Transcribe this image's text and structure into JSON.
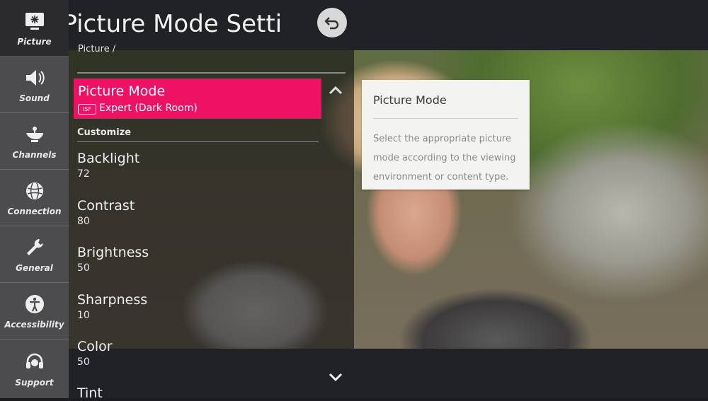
{
  "sidebar": {
    "items": [
      {
        "label": "Picture",
        "icon": "picture-icon",
        "active": true
      },
      {
        "label": "Sound",
        "icon": "speaker-icon"
      },
      {
        "label": "Channels",
        "icon": "satellite-dish-icon"
      },
      {
        "label": "Connection",
        "icon": "globe-icon"
      },
      {
        "label": "General",
        "icon": "wrench-icon"
      },
      {
        "label": "Accessibility",
        "icon": "accessibility-icon"
      },
      {
        "label": "Support",
        "icon": "headset-icon"
      }
    ]
  },
  "header": {
    "title": "Picture Mode Settings",
    "breadcrumb": "Picture /"
  },
  "picture_mode": {
    "label": "Picture Mode",
    "badge": "ISF",
    "value": "Expert (Dark Room)"
  },
  "section_label": "Customize",
  "settings": [
    {
      "name": "Backlight",
      "value": "72"
    },
    {
      "name": "Contrast",
      "value": "80"
    },
    {
      "name": "Brightness",
      "value": "50"
    },
    {
      "name": "Sharpness",
      "value": "10"
    },
    {
      "name": "Color",
      "value": "50"
    },
    {
      "name": "Tint",
      "value": ""
    }
  ],
  "info_panel": {
    "title": "Picture Mode",
    "description": "Select the appropriate picture mode according to the viewing environment or content type."
  },
  "colors": {
    "accent": "#ef1163",
    "sidebar": "#4c4c4e",
    "sidebar_active": "#2b2b2e"
  }
}
